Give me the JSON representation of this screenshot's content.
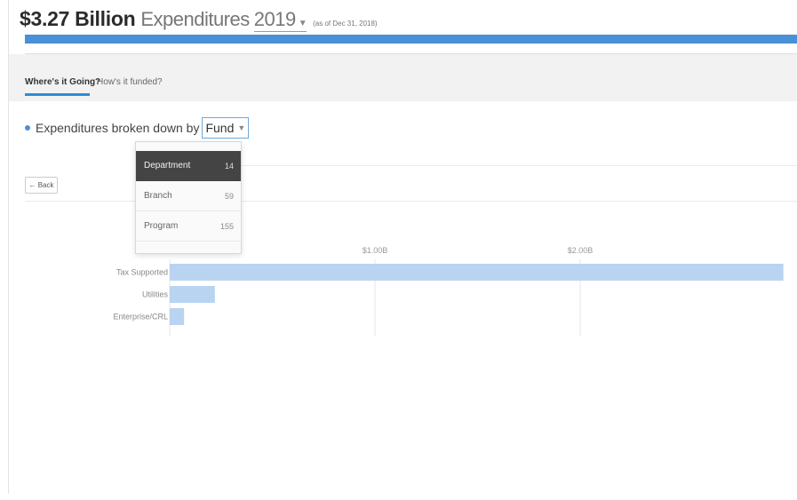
{
  "header": {
    "amount": "$3.27 Billion",
    "label": "Expenditures",
    "year": "2019",
    "as_of": "(as of Dec 31, 2018)"
  },
  "tabs": [
    {
      "label": "Where's it Going?",
      "active": true
    },
    {
      "label": "How's it funded?",
      "active": false
    }
  ],
  "breakdown": {
    "prefix": "Expenditures broken down by",
    "selected": "Fund"
  },
  "dropdown": {
    "options": [
      {
        "label": "Department",
        "count": "14",
        "selected": true
      },
      {
        "label": "Branch",
        "count": "59",
        "selected": false
      },
      {
        "label": "Program",
        "count": "155",
        "selected": false
      }
    ]
  },
  "back_button": {
    "label": "← Back"
  },
  "colors": {
    "accent": "#4a90d6",
    "bar": "#b8d4f0",
    "dropdown_selected": "#444444"
  },
  "chart_data": {
    "type": "bar",
    "orientation": "horizontal",
    "categories": [
      "Tax Supported",
      "Utilities",
      "Enterprise/CRL"
    ],
    "values": [
      2.99,
      0.22,
      0.07
    ],
    "unit": "B",
    "xlim": [
      0,
      3.0
    ],
    "ticks": [
      {
        "value": 1.0,
        "label": "$1.00B"
      },
      {
        "value": 2.0,
        "label": "$2.00B"
      }
    ],
    "grid": true
  }
}
